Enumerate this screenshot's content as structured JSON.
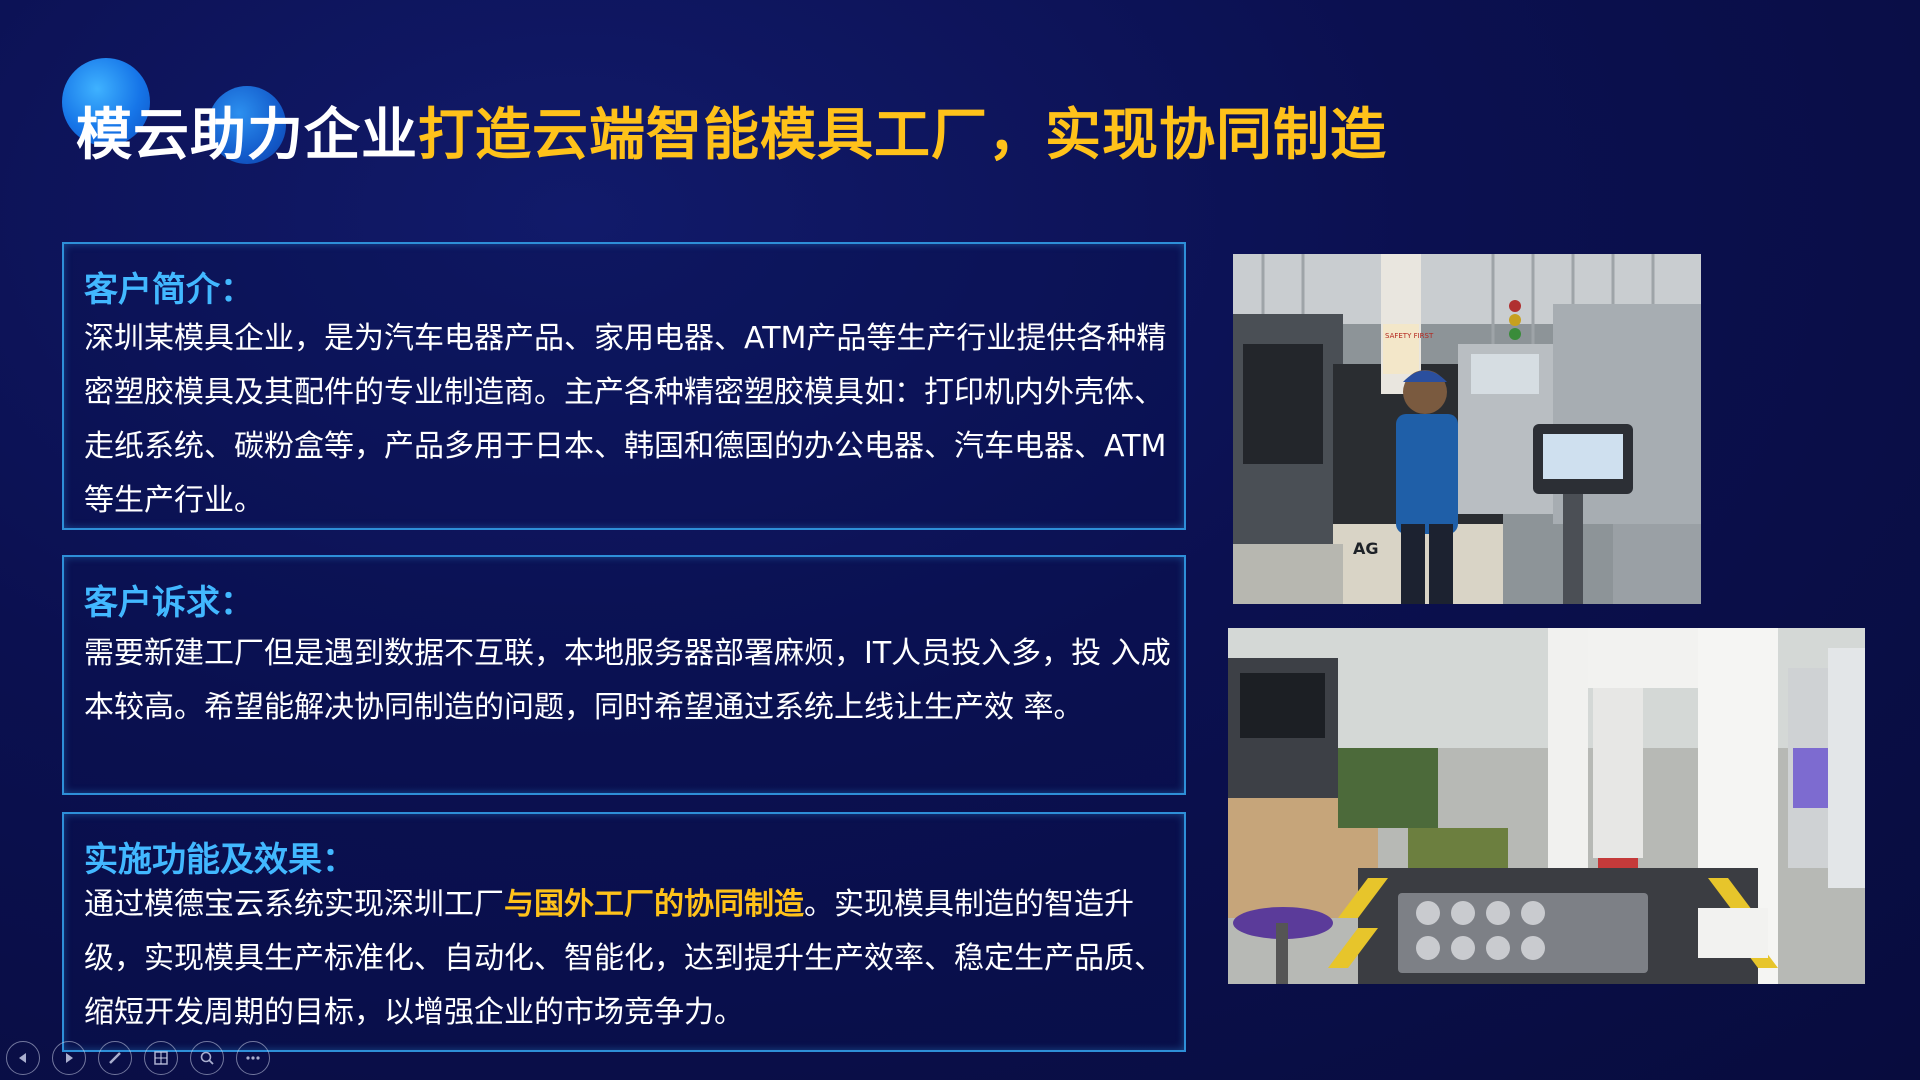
{
  "title": {
    "part1": "模云助力企业",
    "part2": "打造云端智能模具工厂，实现协同制造"
  },
  "panels": [
    {
      "heading": "客户简介：",
      "body": "深圳某模具企业，是为汽车电器产品、家用电器、ATM产品等生产行业提供各种精密塑胶模具及其配件的专业制造商。主产各种精密塑胶模具如：打印机内外壳体、走纸系统、碳粉盒等，产品多用于日本、韩国和德国的办公电器、汽车电器、ATM等生产行业。"
    },
    {
      "heading": "客户诉求：",
      "body": "需要新建工厂但是遇到数据不互联，本地服务器部署麻烦，IT人员投入多，投 入成本较高。希望能解决协同制造的问题，同时希望通过系统上线让生产效 率。"
    },
    {
      "heading": "实施功能及效果：",
      "body_before": "通过模德宝云系统实现深圳工厂",
      "body_highlight": "与国外工厂的协同制造",
      "body_after": "。实现模具制造的智造升级，实现模具生产标准化、自动化、智能化，达到提升生产效率、稳定生产品质、缩短开发周期的目标，以增强企业的市场竞争力。"
    }
  ],
  "photos": {
    "machine_label_1": "AG",
    "machine_label_2": "SAFETY FIRST"
  },
  "toolbar": {
    "icons": [
      "previous-icon",
      "next-icon",
      "pen-icon",
      "slides-icon",
      "zoom-icon",
      "more-icon"
    ]
  },
  "colors": {
    "background": "#0b1050",
    "accent_yellow": "#ffc21a",
    "heading_blue": "#42b8ff",
    "panel_border": "#2e8fd8"
  }
}
